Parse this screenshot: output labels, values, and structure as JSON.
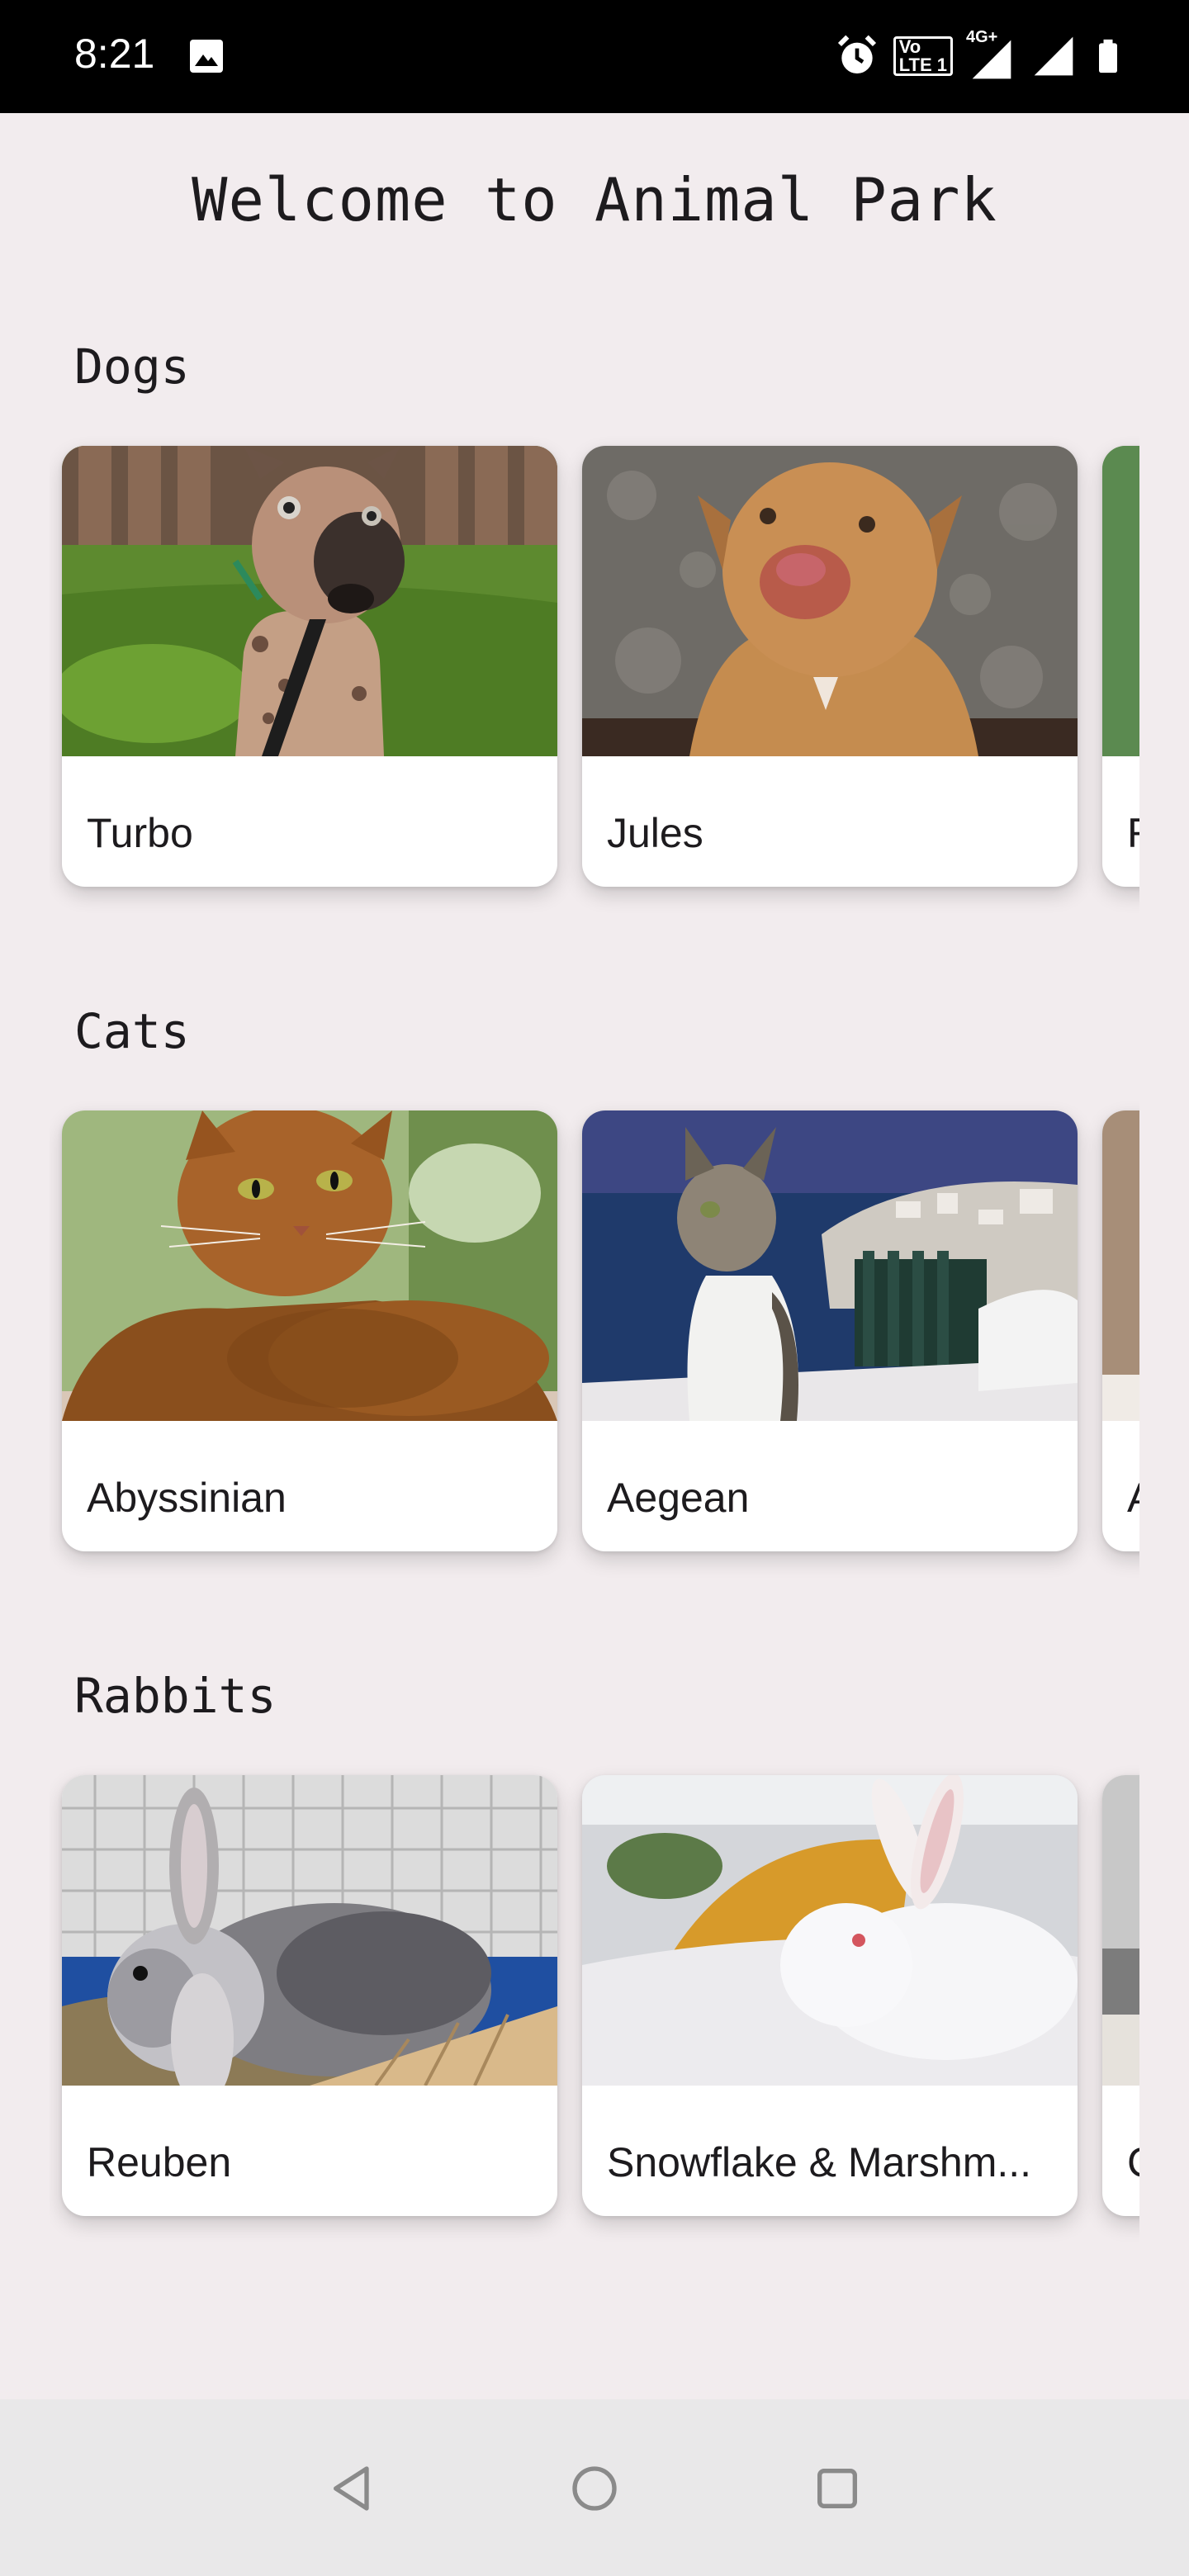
{
  "status_bar": {
    "time": "8:21",
    "network": "4G+",
    "volte_top": "Vo",
    "volte_bottom": "LTE 1"
  },
  "title": "Welcome to Animal Park",
  "sections": [
    {
      "title": "Dogs",
      "cards": [
        {
          "label": "Turbo",
          "photo": "spotted-puppy-on-grass"
        },
        {
          "label": "Jules",
          "photo": "tan-pitbull-portrait"
        },
        {
          "label": "R",
          "photo": "green-background-partial"
        }
      ]
    },
    {
      "title": "Cats",
      "cards": [
        {
          "label": "Abyssinian",
          "photo": "orange-cat-lying"
        },
        {
          "label": "Aegean",
          "photo": "white-tabby-cat-by-sea"
        },
        {
          "label": "A",
          "photo": "tan-partial"
        }
      ]
    },
    {
      "title": "Rabbits",
      "cards": [
        {
          "label": "Reuben",
          "photo": "grey-lop-rabbit-in-cage"
        },
        {
          "label": "Snowflake & Marshm...",
          "photo": "white-rabbit-on-bed"
        },
        {
          "label": "C",
          "photo": "grey-partial"
        }
      ]
    }
  ],
  "nav": {
    "back": "back-icon",
    "home": "home-icon",
    "recents": "recents-icon"
  },
  "colors": {
    "background": "#f2ecee",
    "status_bar": "#000000",
    "card": "#ffffff",
    "text": "#1d1b1e",
    "nav_bar": "#e9e8e9",
    "nav_icon": "#8a8a8a"
  }
}
